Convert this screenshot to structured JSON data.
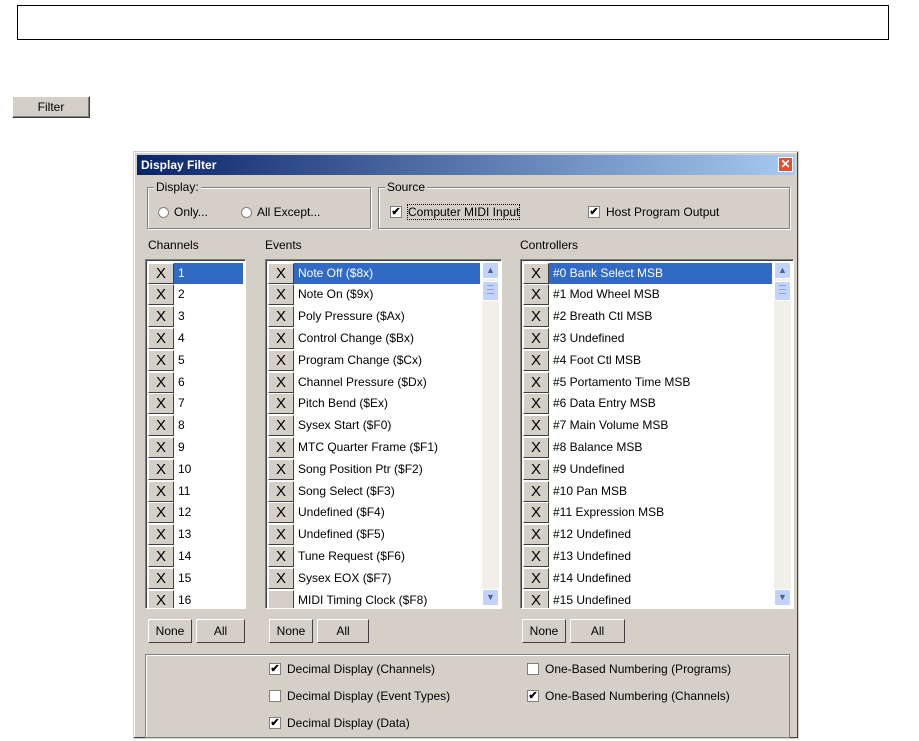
{
  "filter_button": "Filter",
  "dialog": {
    "title": "Display Filter",
    "close_icon": "close-icon",
    "display_group": {
      "label": "Display:",
      "options": [
        "Only...",
        "All Except..."
      ]
    },
    "source_group": {
      "label": "Source",
      "options": [
        {
          "label": "Computer MIDI Input",
          "checked": true
        },
        {
          "label": "Host Program Output",
          "checked": true
        }
      ]
    },
    "channels": {
      "label": "Channels",
      "items": [
        "1",
        "2",
        "3",
        "4",
        "5",
        "6",
        "7",
        "8",
        "9",
        "10",
        "11",
        "12",
        "13",
        "14",
        "15",
        "16"
      ]
    },
    "events": {
      "label": "Events",
      "items": [
        "Note Off ($8x)",
        "Note On ($9x)",
        "Poly Pressure ($Ax)",
        "Control Change ($Bx)",
        "Program Change ($Cx)",
        "Channel Pressure ($Dx)",
        "Pitch Bend ($Ex)",
        "Sysex Start ($F0)",
        "MTC Quarter Frame ($F1)",
        "Song Position Ptr ($F2)",
        "Song Select ($F3)",
        "Undefined ($F4)",
        "Undefined ($F5)",
        "Tune Request ($F6)",
        "Sysex EOX ($F7)",
        "MIDI Timing Clock ($F8)"
      ]
    },
    "controllers": {
      "label": "Controllers",
      "items": [
        "#0 Bank Select MSB",
        "#1 Mod Wheel MSB",
        "#2 Breath Ctl MSB",
        "#3 Undefined",
        "#4 Foot Ctl MSB",
        "#5 Portamento Time MSB",
        "#6 Data Entry MSB",
        "#7 Main Volume MSB",
        "#8 Balance MSB",
        "#9 Undefined",
        "#10 Pan MSB",
        "#11 Expression MSB",
        "#12 Undefined",
        "#13 Undefined",
        "#14 Undefined",
        "#15 Undefined"
      ]
    },
    "x_mark": "X",
    "none_label": "None",
    "all_label": "All",
    "options": {
      "decimal_channels": {
        "label": "Decimal Display (Channels)",
        "checked": true
      },
      "decimal_event_types": {
        "label": "Decimal Display (Event Types)",
        "checked": false
      },
      "decimal_data": {
        "label": "Decimal Display (Data)",
        "checked": true
      },
      "one_based_programs": {
        "label": "One-Based Numbering (Programs)",
        "checked": false
      },
      "one_based_channels": {
        "label": "One-Based Numbering (Channels)",
        "checked": true
      }
    },
    "check_mark": "✔"
  }
}
